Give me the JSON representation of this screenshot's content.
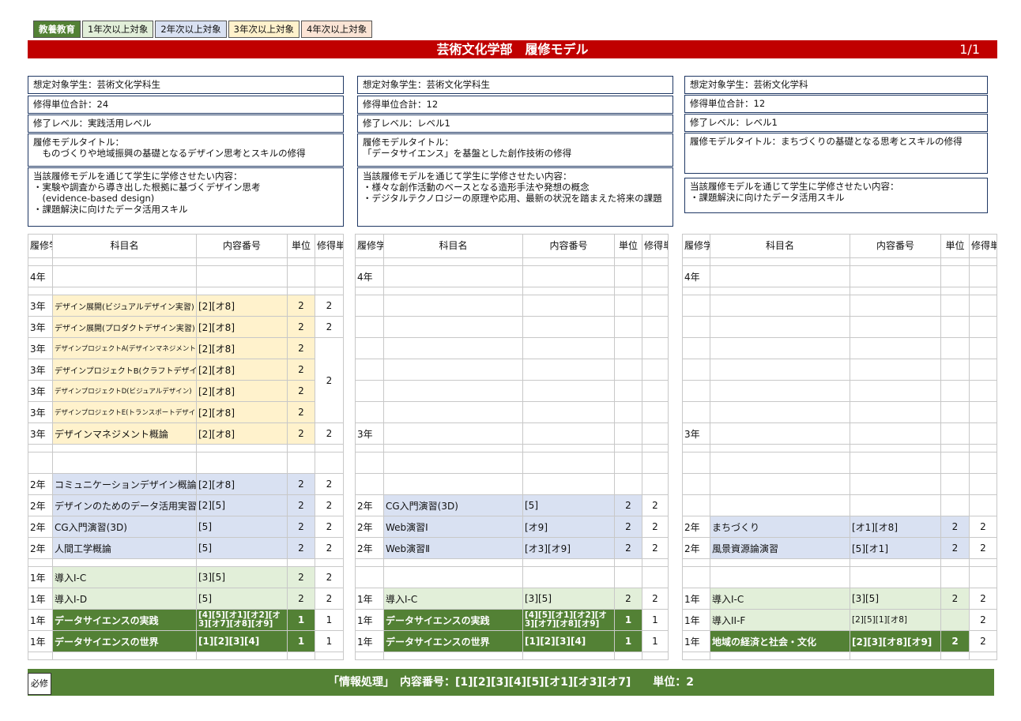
{
  "legend": [
    "教養教育",
    "1年次以上対象",
    "2年次以上対象",
    "3年次以上対象",
    "4年次以上対象"
  ],
  "title": "芸術文化学部　履修モデル",
  "page_number": "1/1",
  "headers": {
    "year": "履修学年",
    "name": "科目名",
    "codes": "内容番号",
    "units": "単位",
    "earned": "修得単位"
  },
  "models": [
    {
      "target": "想定対象学生：芸術文化学科生",
      "total": "修得単位合計：24",
      "level": "修了レベル：実践活用レベル",
      "model_title": "履修モデルタイトル：\n　ものづくりや地域振興の基礎となるデザイン思考とスキルの修得",
      "content": "当該履修モデルを通じて学生に学修させたい内容：\n・実験や調査から導き出した根拠に基づくデザイン思考\n　(evidence-based design)\n・課題解決に向けたデータ活用スキル"
    },
    {
      "target": "想定対象学生：芸術文化学科生",
      "total": "修得単位合計：12",
      "level": "修了レベル：レベル1",
      "model_title": "履修モデルタイトル：\n「データサイエンス」を基盤とした創作技術の修得",
      "content": "当該履修モデルを通じて学生に学修させたい内容：\n・様々な創作活動のベースとなる造形手法や発想の概念\n・デジタルテクノロジーの原理や応用、最新の状況を踏まえた将来の課題"
    },
    {
      "target": "想定対象学生：芸術文化学科",
      "total": "修得単位合計：12",
      "level": "修了レベル：レベル1",
      "model_title": "履修モデルタイトル：まちづくりの基礎となる思考とスキルの修得",
      "content": "当該履修モデルを通じて学生に学修させたい内容：\n・課題解決に向けたデータ活用スキル"
    }
  ],
  "tables": [
    {
      "rows": [
        {
          "year": "",
          "name": "",
          "codes": "",
          "units": "",
          "earned": ""
        },
        {
          "year": "4年",
          "name": "",
          "codes": "",
          "units": "",
          "earned": ""
        },
        {
          "year": "",
          "name": "",
          "codes": "",
          "units": "",
          "earned": ""
        },
        {
          "year": "3年",
          "name": "デザイン展開(ビジュアルデザイン実習)",
          "codes": "[2][オ8]",
          "units": "2",
          "earned": "2"
        },
        {
          "year": "3年",
          "name": "デザイン展開(プロダクトデザイン実習)",
          "codes": "[2][オ8]",
          "units": "2",
          "earned": "2"
        },
        {
          "year": "3年",
          "name": "デザインプロジェクトA(デザインマネジメント)",
          "codes": "[2][オ8]",
          "units": "2",
          "earned": "2"
        },
        {
          "year": "3年",
          "name": "デザインプロジェクトB(クラフトデザイン)",
          "codes": "[2][オ8]",
          "units": "2",
          "earned": ""
        },
        {
          "year": "3年",
          "name": "デザインプロジェクトD(ビジュアルデザイン)",
          "codes": "[2][オ8]",
          "units": "2",
          "earned": ""
        },
        {
          "year": "3年",
          "name": "デザインプロジェクトE(トランスポートデザイン)",
          "codes": "[2][オ8]",
          "units": "2",
          "earned": ""
        },
        {
          "year": "3年",
          "name": "デザインマネジメント概論",
          "codes": "[2][オ8]",
          "units": "2",
          "earned": "2"
        },
        {
          "year": "",
          "name": "",
          "codes": "",
          "units": "",
          "earned": ""
        },
        {
          "year": "",
          "name": "",
          "codes": "",
          "units": "",
          "earned": ""
        },
        {
          "year": "2年",
          "name": "コミュニケーションデザイン概論",
          "codes": "[2][オ8]",
          "units": "2",
          "earned": "2"
        },
        {
          "year": "2年",
          "name": "デザインのためのデータ活用実習",
          "codes": "[2][5]",
          "units": "2",
          "earned": "2"
        },
        {
          "year": "2年",
          "name": "CG入門演習(3D)",
          "codes": "[5]",
          "units": "2",
          "earned": "2"
        },
        {
          "year": "2年",
          "name": "人間工学概論",
          "codes": "[5]",
          "units": "2",
          "earned": "2"
        },
        {
          "year": "",
          "name": "",
          "codes": "",
          "units": "",
          "earned": ""
        },
        {
          "year": "1年",
          "name": "導入I-C",
          "codes": "[3][5]",
          "units": "2",
          "earned": "2"
        },
        {
          "year": "1年",
          "name": "導入I-D",
          "codes": "[5]",
          "units": "2",
          "earned": "2"
        },
        {
          "year": "1年",
          "name": "データサイエンスの実践",
          "codes": "[4][5][オ1][オ2][オ3][オ7][オ8][オ9]",
          "units": "1",
          "earned": "1"
        },
        {
          "year": "1年",
          "name": "データサイエンスの世界",
          "codes": "[1][2][3][4]",
          "units": "1",
          "earned": "1"
        },
        {
          "year": "",
          "name": "",
          "codes": "",
          "units": "",
          "earned": ""
        }
      ]
    },
    {
      "rows": [
        {
          "year": "",
          "name": "",
          "codes": "",
          "units": "",
          "earned": ""
        },
        {
          "year": "4年",
          "name": "",
          "codes": "",
          "units": "",
          "earned": ""
        },
        {
          "year": "",
          "name": "",
          "codes": "",
          "units": "",
          "earned": ""
        },
        {
          "year": "",
          "name": "",
          "codes": "",
          "units": "",
          "earned": ""
        },
        {
          "year": "",
          "name": "",
          "codes": "",
          "units": "",
          "earned": ""
        },
        {
          "year": "",
          "name": "",
          "codes": "",
          "units": "",
          "earned": ""
        },
        {
          "year": "",
          "name": "",
          "codes": "",
          "units": "",
          "earned": ""
        },
        {
          "year": "",
          "name": "",
          "codes": "",
          "units": "",
          "earned": ""
        },
        {
          "year": "",
          "name": "",
          "codes": "",
          "units": "",
          "earned": ""
        },
        {
          "year": "3年",
          "name": "",
          "codes": "",
          "units": "",
          "earned": ""
        },
        {
          "year": "",
          "name": "",
          "codes": "",
          "units": "",
          "earned": ""
        },
        {
          "year": "",
          "name": "",
          "codes": "",
          "units": "",
          "earned": ""
        },
        {
          "year": "",
          "name": "",
          "codes": "",
          "units": "",
          "earned": ""
        },
        {
          "year": "2年",
          "name": "CG入門演習(3D)",
          "codes": "[5]",
          "units": "2",
          "earned": "2"
        },
        {
          "year": "2年",
          "name": "Web演習Ⅰ",
          "codes": "[オ9]",
          "units": "2",
          "earned": "2"
        },
        {
          "year": "2年",
          "name": "Web演習Ⅱ",
          "codes": "[オ3][オ9]",
          "units": "2",
          "earned": "2"
        },
        {
          "year": "",
          "name": "",
          "codes": "",
          "units": "",
          "earned": ""
        },
        {
          "year": "",
          "name": "",
          "codes": "",
          "units": "",
          "earned": ""
        },
        {
          "year": "1年",
          "name": "導入I-C",
          "codes": "[3][5]",
          "units": "2",
          "earned": "2"
        },
        {
          "year": "1年",
          "name": "データサイエンスの実践",
          "codes": "[4][5][オ1][オ2][オ3][オ7][オ8][オ9]",
          "units": "1",
          "earned": "1"
        },
        {
          "year": "1年",
          "name": "データサイエンスの世界",
          "codes": "[1][2][3][4]",
          "units": "1",
          "earned": "1"
        },
        {
          "year": "",
          "name": "",
          "codes": "",
          "units": "",
          "earned": ""
        }
      ]
    },
    {
      "rows": [
        {
          "year": "",
          "name": "",
          "codes": "",
          "units": "",
          "earned": ""
        },
        {
          "year": "4年",
          "name": "",
          "codes": "",
          "units": "",
          "earned": ""
        },
        {
          "year": "",
          "name": "",
          "codes": "",
          "units": "",
          "earned": ""
        },
        {
          "year": "",
          "name": "",
          "codes": "",
          "units": "",
          "earned": ""
        },
        {
          "year": "",
          "name": "",
          "codes": "",
          "units": "",
          "earned": ""
        },
        {
          "year": "",
          "name": "",
          "codes": "",
          "units": "",
          "earned": ""
        },
        {
          "year": "",
          "name": "",
          "codes": "",
          "units": "",
          "earned": ""
        },
        {
          "year": "",
          "name": "",
          "codes": "",
          "units": "",
          "earned": ""
        },
        {
          "year": "",
          "name": "",
          "codes": "",
          "units": "",
          "earned": ""
        },
        {
          "year": "3年",
          "name": "",
          "codes": "",
          "units": "",
          "earned": ""
        },
        {
          "year": "",
          "name": "",
          "codes": "",
          "units": "",
          "earned": ""
        },
        {
          "year": "",
          "name": "",
          "codes": "",
          "units": "",
          "earned": ""
        },
        {
          "year": "",
          "name": "",
          "codes": "",
          "units": "",
          "earned": ""
        },
        {
          "year": "",
          "name": "",
          "codes": "",
          "units": "",
          "earned": ""
        },
        {
          "year": "2年",
          "name": "まちづくり",
          "codes": "[オ1][オ8]",
          "units": "2",
          "earned": "2"
        },
        {
          "year": "2年",
          "name": "風景資源論演習",
          "codes": "[5][オ1]",
          "units": "2",
          "earned": "2"
        },
        {
          "year": "",
          "name": "",
          "codes": "",
          "units": "",
          "earned": ""
        },
        {
          "year": "",
          "name": "",
          "codes": "",
          "units": "",
          "earned": ""
        },
        {
          "year": "1年",
          "name": "導入I-C",
          "codes": "[3][5]",
          "units": "2",
          "earned": "2"
        },
        {
          "year": "1年",
          "name": "導入II-F",
          "codes": "[2][5][1][オ8]",
          "units": "",
          "earned": "2"
        },
        {
          "year": "1年",
          "name": "地域の経済と社会・文化",
          "codes": "[2][3][オ8][オ9]",
          "units": "2",
          "earned": "2"
        },
        {
          "year": "",
          "name": "",
          "codes": "",
          "units": "",
          "earned": ""
        }
      ]
    }
  ],
  "footer": {
    "required_label": "必修",
    "text": "「情報処理」　内容番号：[1][2][3][4][5][オ1][オ3][オ7]　　単位：2"
  },
  "colors": {
    "title_bar": "#c00000",
    "general_education": "#538135",
    "year1": "#e2efd9",
    "year2": "#d9e1f2",
    "year3": "#fff2cc",
    "year4": "#fbe4d5",
    "border": "#1f3864"
  }
}
